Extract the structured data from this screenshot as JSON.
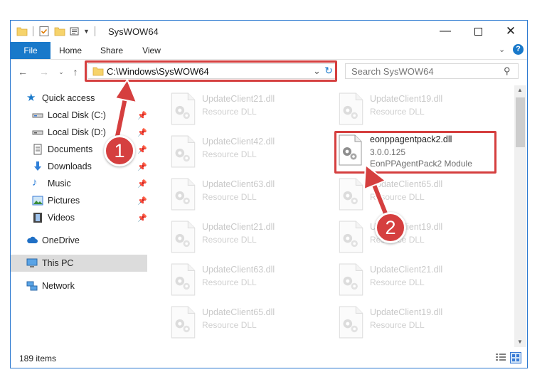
{
  "window": {
    "title": "SysWOW64"
  },
  "ribbon": {
    "tabs": [
      "File",
      "Home",
      "Share",
      "View"
    ]
  },
  "address": {
    "path": "C:\\Windows\\SysWOW64"
  },
  "search": {
    "placeholder": "Search SysWOW64"
  },
  "sidebar": {
    "items": [
      {
        "label": "Quick access"
      },
      {
        "label": "Local Disk (C:)"
      },
      {
        "label": "Local Disk (D:)"
      },
      {
        "label": "Documents"
      },
      {
        "label": "Downloads"
      },
      {
        "label": "Music"
      },
      {
        "label": "Pictures"
      },
      {
        "label": "Videos"
      },
      {
        "label": "OneDrive"
      },
      {
        "label": "This PC"
      },
      {
        "label": "Network"
      }
    ]
  },
  "files": [
    {
      "name": "UpdateClient21.dll",
      "type": "Resource DLL"
    },
    {
      "name": "UpdateClient19.dll",
      "type": "Resource DLL"
    },
    {
      "name": "UpdateClient42.dll",
      "type": "Resource DLL"
    },
    {
      "name": "UpdateClient63.dll",
      "type": "Resource DLL"
    },
    {
      "name": "UpdateClient65.dll",
      "type": "Resource DLL"
    },
    {
      "name": "UpdateClient21.dll",
      "type": "Resource DLL"
    },
    {
      "name": "UpdateClient19.dll",
      "type": "Resource DLL"
    },
    {
      "name": "UpdateClient63.dll",
      "type": "Resource DLL"
    },
    {
      "name": "UpdateClient21.dll",
      "type": "Resource DLL"
    },
    {
      "name": "UpdateClient65.dll",
      "type": "Resource DLL"
    },
    {
      "name": "UpdateClient19.dll",
      "type": "Resource DLL"
    }
  ],
  "highlighted_file": {
    "name": "eonppagentpack2.dll",
    "version": "3.0.0.125",
    "description": "EonPPAgentPack2 Module"
  },
  "status": {
    "item_count": "189 items"
  },
  "callouts": {
    "one": "1",
    "two": "2"
  },
  "colors": {
    "accent": "#1979ca",
    "highlight": "#d53f3f"
  }
}
